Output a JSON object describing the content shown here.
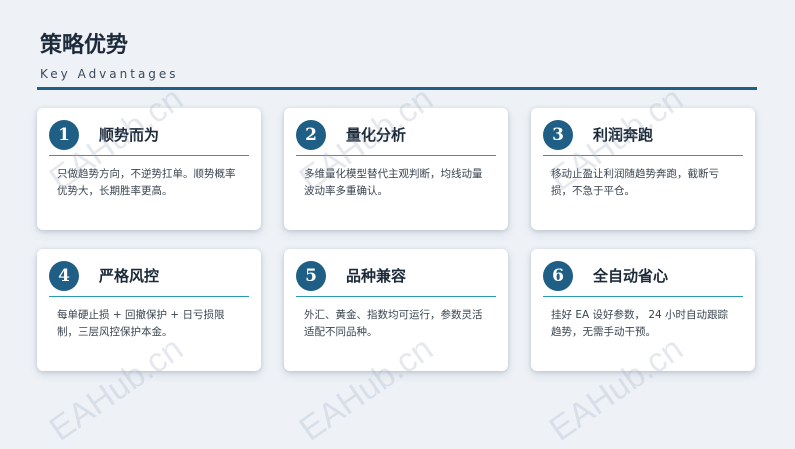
{
  "header": {
    "title": "策略优势",
    "subtitle": "Key Advantages"
  },
  "cards": [
    {
      "number": "1",
      "title": "顺势而为",
      "desc": "只做趋势方向，不逆势扛单。顺势概率优势大，长期胜率更高。"
    },
    {
      "number": "2",
      "title": "量化分析",
      "desc": "多维量化模型替代主观判断，均线动量波动率多重确认。"
    },
    {
      "number": "3",
      "title": "利润奔跑",
      "desc": "移动止盈让利润随趋势奔跑，截断亏损，不急于平仓。"
    },
    {
      "number": "4",
      "title": "严格风控",
      "desc": "每单硬止损 + 回撤保护 + 日亏损限制，三层风控保护本金。"
    },
    {
      "number": "5",
      "title": "品种兼容",
      "desc": "外汇、黄金、指数均可运行，参数灵活适配不同品种。"
    },
    {
      "number": "6",
      "title": "全自动省心",
      "desc": "挂好 EA 设好参数， 24 小时自动跟踪趋势，无需手动干预。"
    }
  ],
  "watermark": "EAHub.cn",
  "colors": {
    "accent": "#1f5f86",
    "card_rule": "#2a9ab0",
    "background": "#eef2f7"
  }
}
